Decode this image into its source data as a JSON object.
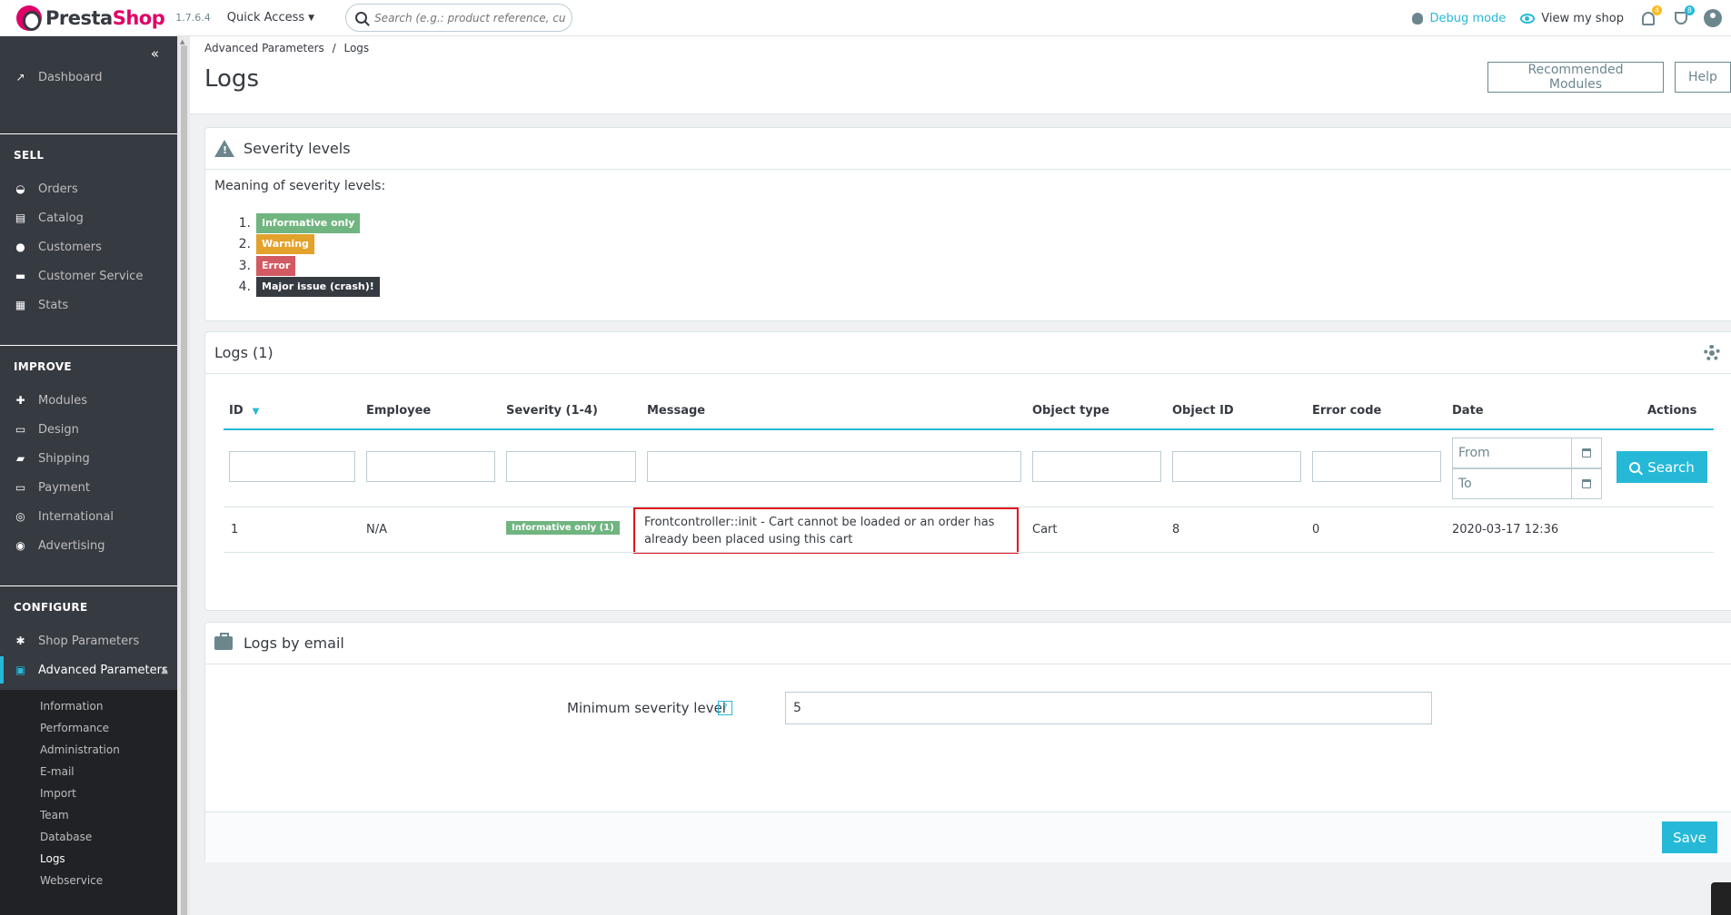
{
  "header": {
    "brand_pre": "Presta",
    "brand_post": "Shop",
    "version": "1.7.6.4",
    "quick_access": "Quick Access",
    "search_placeholder": "Search (e.g.: product reference, customer name...)",
    "debug_mode": "Debug mode",
    "view_shop": "View my shop",
    "notif_count": "4",
    "trophy_count": "8"
  },
  "sidebar": {
    "dashboard": "Dashboard",
    "sell": "SELL",
    "sell_items": [
      "Orders",
      "Catalog",
      "Customers",
      "Customer Service",
      "Stats"
    ],
    "improve": "IMPROVE",
    "improve_items": [
      "Modules",
      "Design",
      "Shipping",
      "Payment",
      "International",
      "Advertising"
    ],
    "configure": "CONFIGURE",
    "configure_items": [
      "Shop Parameters",
      "Advanced Parameters"
    ],
    "sub_items": [
      "Information",
      "Performance",
      "Administration",
      "E-mail",
      "Import",
      "Team",
      "Database",
      "Logs",
      "Webservice"
    ]
  },
  "page": {
    "breadcrumb_parent": "Advanced Parameters",
    "breadcrumb_sep": "/",
    "breadcrumb_current": "Logs",
    "title": "Logs",
    "recommended_modules": "Recommended Modules",
    "help": "Help"
  },
  "severity": {
    "title": "Severity levels",
    "intro": "Meaning of severity levels:",
    "levels": [
      {
        "num": "1.",
        "label": "Informative only",
        "color": "#70b580"
      },
      {
        "num": "2.",
        "label": "Warning",
        "color": "#e2a22b"
      },
      {
        "num": "3.",
        "label": "Error",
        "color": "#d25a63"
      },
      {
        "num": "4.",
        "label": "Major issue (crash)!",
        "color": "#363a41"
      }
    ]
  },
  "logs": {
    "title": "Logs (1)",
    "columns": [
      "ID",
      "Employee",
      "Severity (1-4)",
      "Message",
      "Object type",
      "Object ID",
      "Error code",
      "Date",
      "Actions"
    ],
    "date_from_placeholder": "From",
    "date_to_placeholder": "To",
    "search_label": "Search",
    "rows": [
      {
        "id": "1",
        "employee": "N/A",
        "severity": "Informative only (1)",
        "message": "Frontcontroller::init - Cart cannot be loaded or an order has already been placed using this cart",
        "object_type": "Cart",
        "object_id": "8",
        "error_code": "0",
        "date": "2020-03-17 12:36"
      }
    ]
  },
  "email": {
    "title": "Logs by email",
    "label": "Minimum severity level",
    "help": "?",
    "value": "5",
    "save": "Save"
  },
  "colors": {
    "accent": "#25b9d7",
    "brand": "#df0067",
    "sidebar_bg": "#363a41"
  }
}
